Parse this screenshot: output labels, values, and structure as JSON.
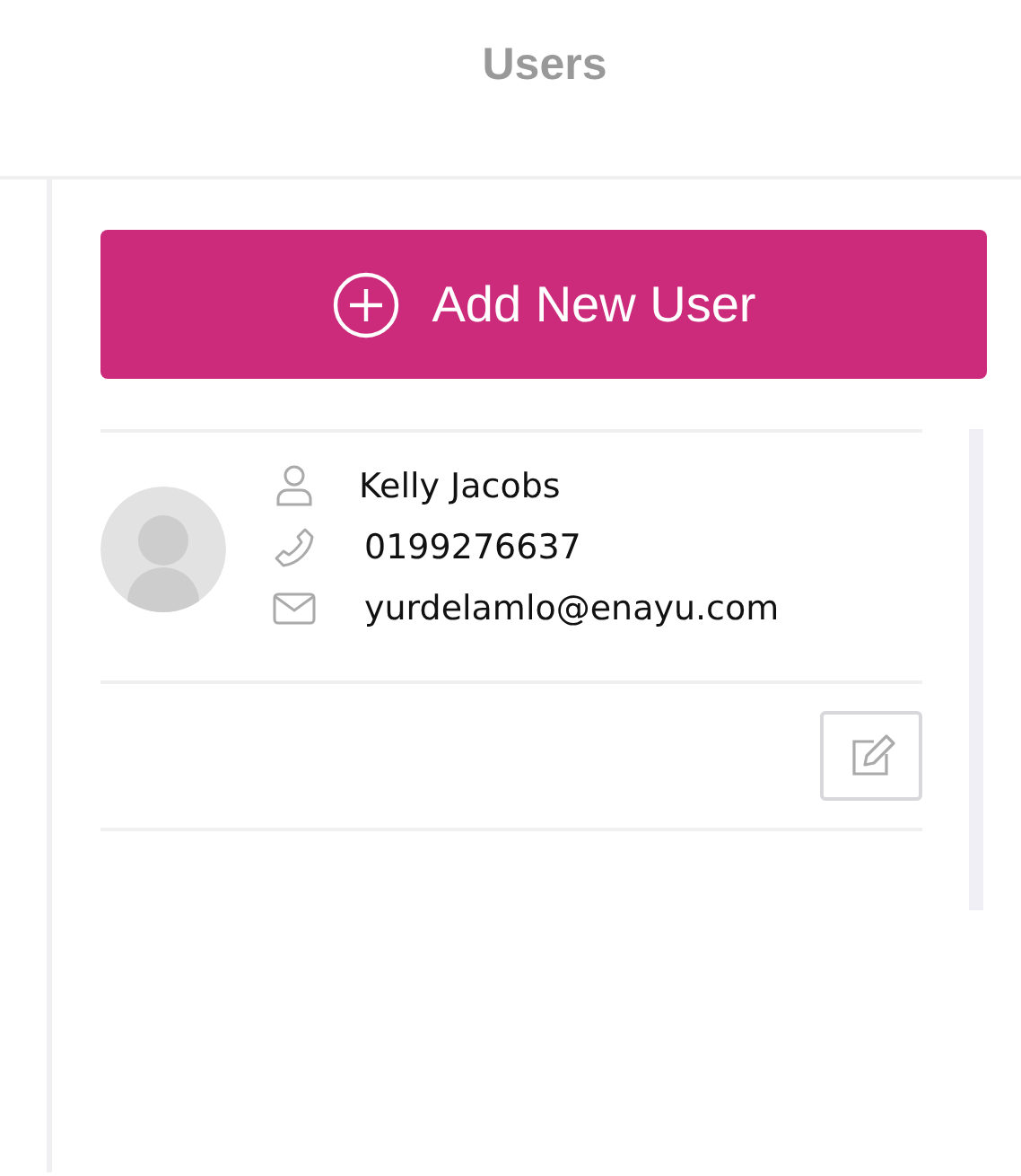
{
  "header": {
    "title": "Users"
  },
  "add_button": {
    "label": "Add New User"
  },
  "users": [
    {
      "fields": [
        {
          "kind": "name",
          "text": "Kelly Jacobs"
        },
        {
          "kind": "phone",
          "text": "0199276637"
        },
        {
          "kind": "email",
          "text": "yurdelamlo@enayu.com"
        }
      ]
    }
  ]
}
